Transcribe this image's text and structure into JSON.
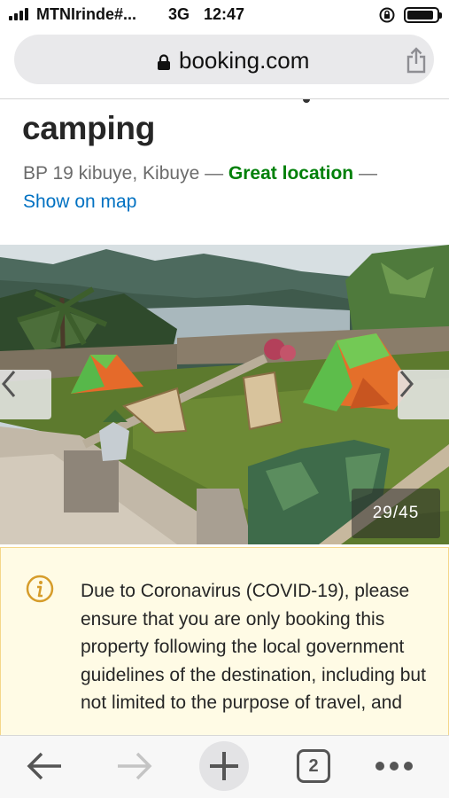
{
  "status_bar": {
    "carrier": "MTNIrinde#...",
    "network": "3G",
    "time": "12:47"
  },
  "address_bar": {
    "domain": "booking.com",
    "lock_icon": "lock-icon",
    "share_icon": "share-icon"
  },
  "property": {
    "name": "camping",
    "address": "BP 19 kibuye, Kibuye —",
    "location_badge": "Great location",
    "separator": "—",
    "map_link": "Show on map"
  },
  "gallery": {
    "counter": "29/45",
    "prev_icon": "chevron-left-icon",
    "next_icon": "chevron-right-icon"
  },
  "notice": {
    "icon": "info-icon",
    "text": "Due to Coronavirus (COVID-19), please ensure that you are only booking this property following the local government guidelines of the destination, including but not limited to the purpose of travel, and"
  },
  "toolbar": {
    "back_icon": "back-arrow-icon",
    "forward_icon": "forward-arrow-icon",
    "new_tab_icon": "plus-icon",
    "tab_count": "2",
    "more_icon": "more-dots-icon"
  },
  "colors": {
    "green_accent": "#008009",
    "link_blue": "#0071c2",
    "notice_bg": "#fffbe5",
    "notice_border": "#f5d78a",
    "info_icon": "#d69c2a"
  }
}
